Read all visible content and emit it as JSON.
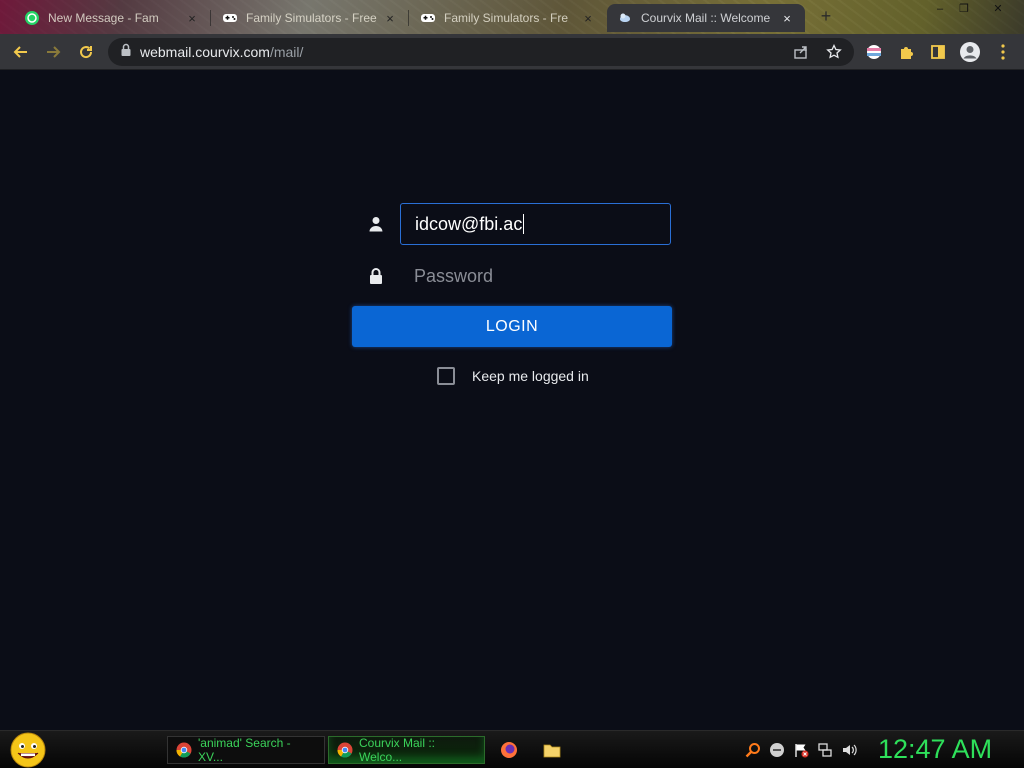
{
  "browser": {
    "tabs": [
      {
        "title": "New Message - Fam",
        "close": "×",
        "favicon": "whatsapp-icon"
      },
      {
        "title": "Family Simulators - Free",
        "close": "×",
        "favicon": "gamepad-icon"
      },
      {
        "title": "Family Simulators - Fre",
        "close": "×",
        "favicon": "gamepad-icon"
      },
      {
        "title": "Courvix Mail :: Welcome",
        "close": "×",
        "favicon": "courvix-icon",
        "active": true
      }
    ],
    "new_tab": "+",
    "window_controls": {
      "minimize": "–",
      "maximize": "❐",
      "close": "✕"
    },
    "address": {
      "host": "webmail.courvix.com",
      "path": "/mail/"
    }
  },
  "login": {
    "username_value": "idcow@fbi.ac",
    "password_placeholder": "Password",
    "login_label": "LOGIN",
    "keep_logged_in_label": "Keep me logged in"
  },
  "taskbar": {
    "tasks": [
      {
        "label": "'animad' Search - XV..."
      },
      {
        "label": "Courvix Mail :: Welco..."
      }
    ],
    "clock": "12:47 AM"
  },
  "colors": {
    "page_bg": "#0b0d17",
    "login_button": "#0a66d4",
    "focus_border": "#2a6fd6",
    "clock": "#2ee05a"
  }
}
